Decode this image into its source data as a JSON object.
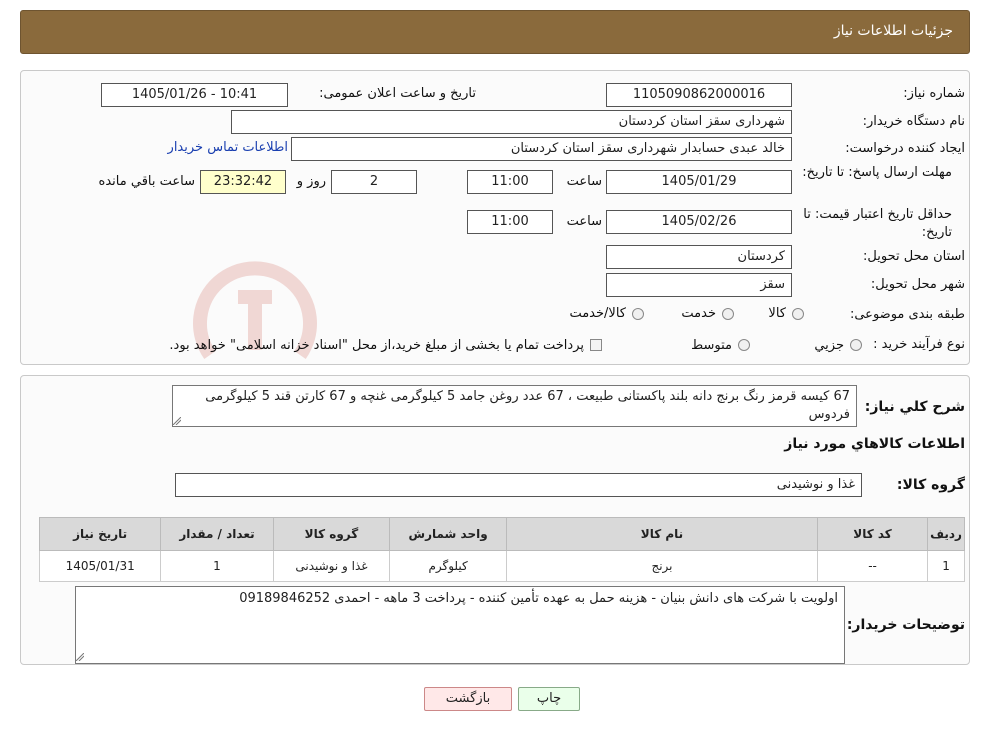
{
  "header": {
    "title": "جزئیات اطلاعات نیاز"
  },
  "form": {
    "need_number_label": "شماره نیاز:",
    "need_number": "1105090862000016",
    "announce_label": "تاریخ و ساعت اعلان عمومی:",
    "announce_value": "1405/01/26 - 10:41",
    "buyer_org_label": "نام دستگاه خریدار:",
    "buyer_org": "شهرداری سقز استان کردستان",
    "creator_label": "ایجاد کننده درخواست:",
    "creator": "خالد عبدی حسابدار شهرداری سقز استان کردستان",
    "contact_link": "اطلاعات تماس خریدار",
    "deadline_label": "مهلت ارسال پاسخ: تا تاریخ:",
    "deadline_date": "1405/01/29",
    "time_label": "ساعت",
    "deadline_time": "11:00",
    "days_value": "2",
    "days_label": "روز و",
    "remaining_time": "23:32:42",
    "remaining_label": "ساعت باقي مانده",
    "validity_label": "حداقل تاریخ اعتبار قیمت: تا تاریخ:",
    "validity_date": "1405/02/26",
    "validity_time": "11:00",
    "province_label": "استان محل تحویل:",
    "province": "کردستان",
    "city_label": "شهر محل تحویل:",
    "city": "سقز",
    "category_label": "طبقه بندی موضوعی:",
    "category_options": [
      "کالا",
      "خدمت",
      "کالا/خدمت"
    ],
    "process_label": "نوع فرآیند خرید :",
    "process_options": [
      "جزیي",
      "متوسط"
    ],
    "process_note": "پرداخت تمام یا بخشی از مبلغ خرید،از محل \"اسناد خزانه اسلامی\" خواهد بود."
  },
  "description": {
    "label": "شرح كلي نياز:",
    "text": "67 کیسه قرمز رنگ برنج دانه بلند پاکستانی طبیعت ، 67 عدد روغن جامد 5 کیلوگرمی غنچه و 67 کارتن قند 5 کیلوگرمی فردوس"
  },
  "goods": {
    "section_title": "اطلاعات كالاهاي مورد نياز",
    "group_label": "گروه كالا:",
    "group_value": "غذا و نوشیدنی",
    "columns": [
      "رديف",
      "كد كالا",
      "نام كالا",
      "واحد شمارش",
      "گروه كالا",
      "تعداد / مقدار",
      "تاريخ نياز"
    ],
    "rows": [
      [
        "1",
        "--",
        "برنج",
        "کیلوگرم",
        "غذا و نوشیدنی",
        "1",
        "1405/01/31"
      ]
    ]
  },
  "buyer_notes": {
    "label": "توضیحات خریدار:",
    "text": "اولویت با شرکت های دانش بنیان - هزینه حمل به عهده تأمین کننده - پرداخت 3 ماهه - احمدی 09189846252"
  },
  "buttons": {
    "print": "چاپ",
    "back": "بازگشت"
  },
  "colors": {
    "header_bg": "#8a6a3c",
    "remaining_bg": "#ffffcc",
    "back_bg": "#ffe8e8",
    "print_bg": "#eaffea"
  }
}
